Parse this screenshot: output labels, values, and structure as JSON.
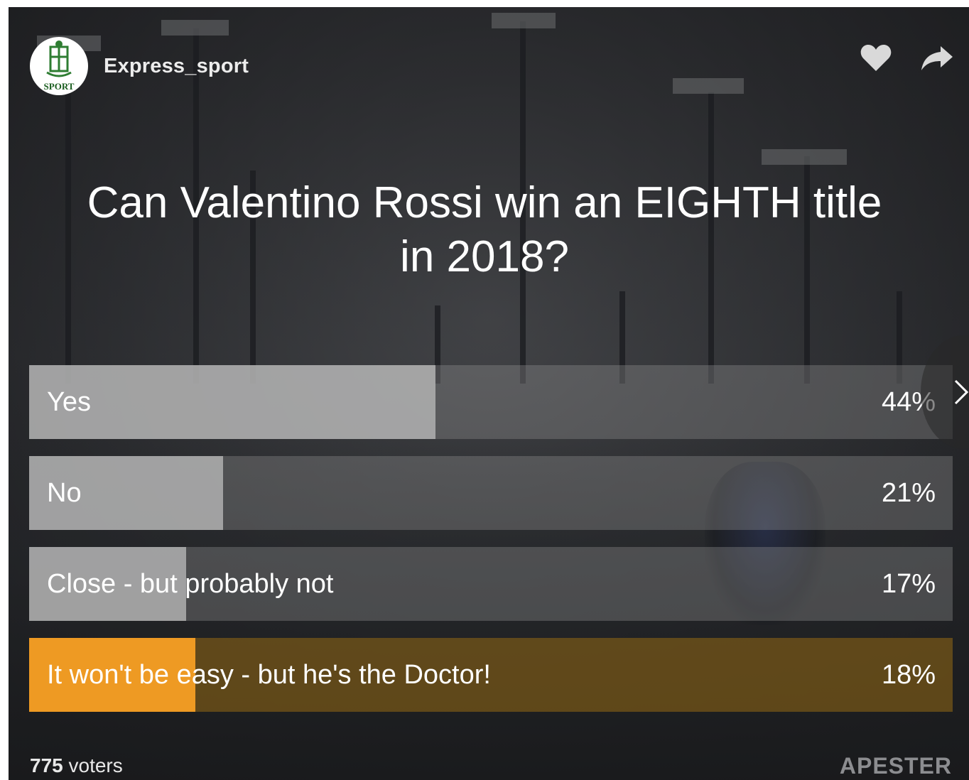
{
  "publisher": {
    "name": "Express_sport",
    "avatar_text": "SPORT"
  },
  "actions": {
    "like_icon": "heart-icon",
    "share_icon": "share-arrow-icon"
  },
  "poll": {
    "question": "Can Valentino Rossi win an EIGHTH title in 2018?",
    "options": [
      {
        "label": "Yes",
        "percent_text": "44%",
        "percent": 44,
        "selected": false
      },
      {
        "label": "No",
        "percent_text": "21%",
        "percent": 21,
        "selected": false
      },
      {
        "label": "Close - but probably not",
        "percent_text": "17%",
        "percent": 17,
        "selected": false
      },
      {
        "label": "It won't be easy - but he's the Doctor!",
        "percent_text": "18%",
        "percent": 18,
        "selected": true
      }
    ],
    "accent_color": "#ee9a23"
  },
  "footer": {
    "voters_count": "775",
    "voters_label": "voters",
    "brand": "APESTER"
  }
}
